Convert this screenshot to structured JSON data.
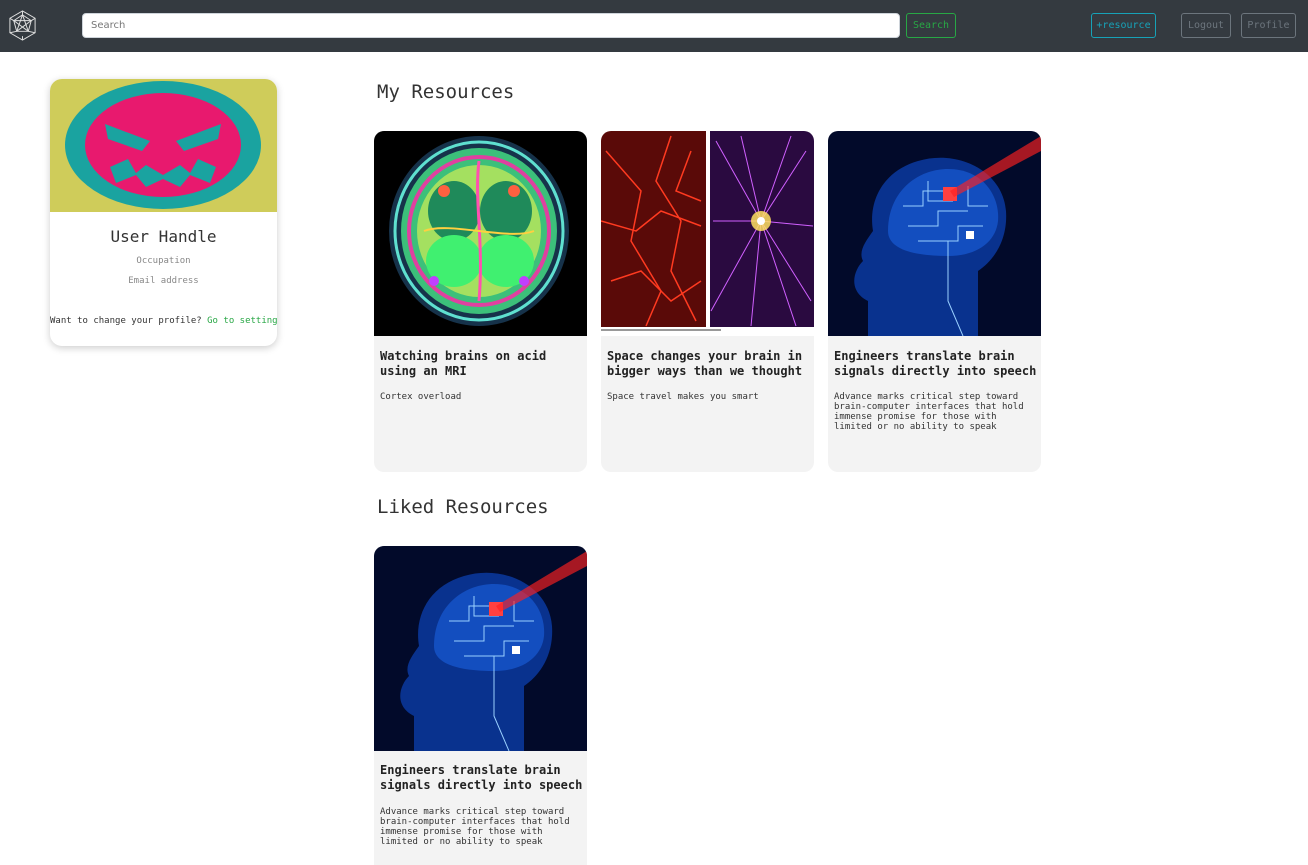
{
  "navbar": {
    "logo_icon": "geodesic-sphere-logo-icon",
    "search_placeholder": "Search",
    "search_button": "Search",
    "add_resource_button": "+resource",
    "logout_button": "Logout",
    "profile_button": "Profile",
    "colors": {
      "background": "#343a40",
      "search": "#28a745",
      "resource": "#17a2b8",
      "muted": "#6c757d"
    }
  },
  "profile": {
    "avatar_icon": "angry-face-avatar-icon",
    "handle": "User Handle",
    "occupation": "Occupation",
    "email": "Email address",
    "change_prompt": "Want to change your profile?",
    "settings_link": "Go to settings"
  },
  "my_resources": {
    "title": "My Resources",
    "items": [
      {
        "image": "mri-brain-scan-image",
        "title": "Watching brains on acid using an MRI",
        "description": "Cortex overload"
      },
      {
        "image": "neurons-vs-cosmic-web-image",
        "title": "Space changes your brain in bigger ways than we thought",
        "description": "Space travel makes you smart"
      },
      {
        "image": "circuit-brain-head-image",
        "title": "Engineers translate brain signals directly into speech",
        "description": "Advance marks critical step toward brain-computer interfaces that hold immense promise for those with limited or no ability to speak"
      }
    ]
  },
  "liked_resources": {
    "title": "Liked Resources",
    "items": [
      {
        "image": "circuit-brain-head-image",
        "title": "Engineers translate brain signals directly into speech",
        "description": "Advance marks critical step toward brain-computer interfaces that hold immense promise for those with limited or no ability to speak"
      }
    ]
  }
}
